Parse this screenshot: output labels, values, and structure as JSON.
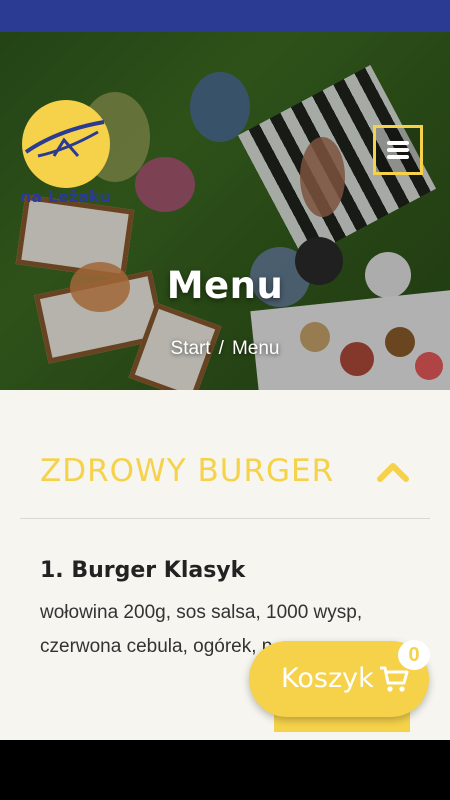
{
  "brand": {
    "logo_text": "na Leżaku"
  },
  "header": {
    "menu_button_icon": "hamburger-icon"
  },
  "hero": {
    "title": "Menu",
    "breadcrumb": {
      "home": "Start",
      "separator": "/",
      "current": "Menu"
    }
  },
  "section": {
    "title": "ZDROWY BURGER",
    "toggle_icon": "chevron-up-icon"
  },
  "menu_items": [
    {
      "name": "1. Burger Klasyk",
      "description": "wołowina 200g, sos salsa, 1000 wysp, czerwona cebula, ogórek, p..."
    }
  ],
  "cart": {
    "label": "Koszyk",
    "count": "0",
    "icon": "cart-icon"
  },
  "colors": {
    "accent": "#f5d24a",
    "topbar": "#2b3b93",
    "background": "#f6f5ef"
  }
}
